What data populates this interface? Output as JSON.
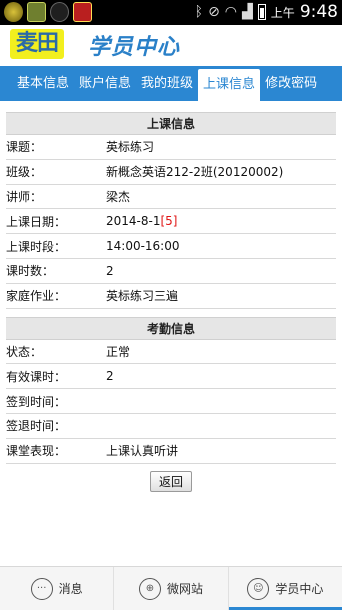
{
  "status_bar": {
    "ampm": "上午",
    "time": "9:48"
  },
  "header": {
    "logo_text": "麦田",
    "title": "学员中心"
  },
  "tabs": [
    {
      "label": "基本信息",
      "active": false
    },
    {
      "label": "账户信息",
      "active": false
    },
    {
      "label": "我的班级",
      "active": false
    },
    {
      "label": "上课信息",
      "active": true
    },
    {
      "label": "修改密码",
      "active": false
    }
  ],
  "class_info": {
    "heading": "上课信息",
    "rows": [
      {
        "key": "课题：",
        "value": "英标练习"
      },
      {
        "key": "班级：",
        "value": "新概念英语212-2班(20120002)"
      },
      {
        "key": "讲师：",
        "value": "梁杰"
      },
      {
        "key": "上课日期：",
        "value": "2014-8-1",
        "extra": "[5]"
      },
      {
        "key": "上课时段：",
        "value": "14:00-16:00"
      },
      {
        "key": "课时数：",
        "value": "2"
      },
      {
        "key": "家庭作业：",
        "value": "英标练习三遍"
      }
    ]
  },
  "attendance_info": {
    "heading": "考勤信息",
    "rows": [
      {
        "key": "状态：",
        "value": "正常"
      },
      {
        "key": "有效课时：",
        "value": "2"
      },
      {
        "key": "签到时间：",
        "value": ""
      },
      {
        "key": "签退时间：",
        "value": ""
      },
      {
        "key": "课堂表现：",
        "value": "上课认真听讲"
      }
    ]
  },
  "back_button": "返回",
  "bottom_nav": [
    {
      "label": "消息",
      "icon": "chat-bubble-icon",
      "active": false
    },
    {
      "label": "微网站",
      "icon": "globe-icon",
      "active": false
    },
    {
      "label": "学员中心",
      "icon": "user-icon",
      "active": true
    }
  ],
  "colors": {
    "accent": "#2b87d2",
    "highlight_red": "#e01616",
    "logo_yellow": "#f2ef1e"
  }
}
